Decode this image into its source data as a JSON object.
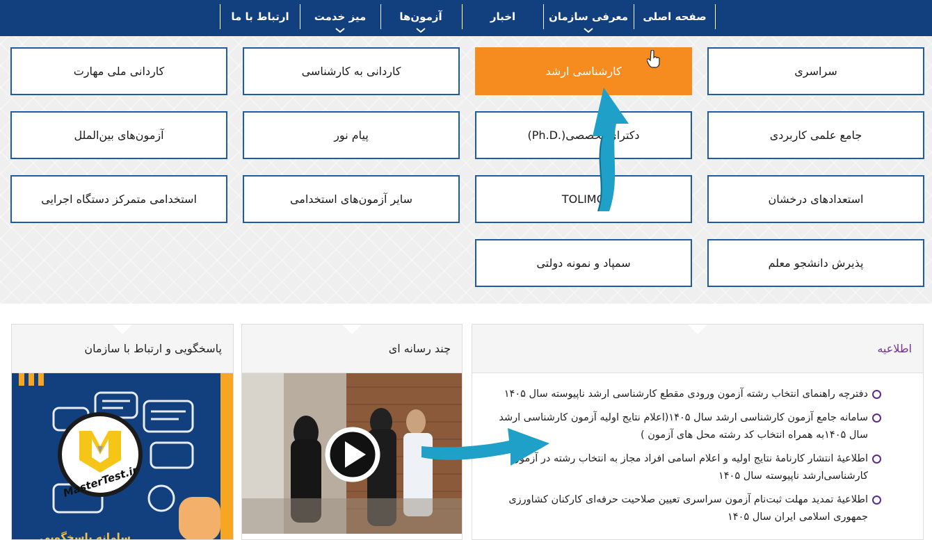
{
  "nav": {
    "items": [
      {
        "label": "صفحه اصلی",
        "dropdown": false
      },
      {
        "label": "معرفی سازمان",
        "dropdown": true
      },
      {
        "label": "اخبار",
        "dropdown": false
      },
      {
        "label": "آزمون‌ها",
        "dropdown": true
      },
      {
        "label": "میز خدمت",
        "dropdown": true
      },
      {
        "label": "ارتباط با ما",
        "dropdown": false
      }
    ]
  },
  "tiles": [
    {
      "label": "سراسری"
    },
    {
      "label": "کارشناسی ارشد",
      "active": true
    },
    {
      "label": "کاردانی به کارشناسی"
    },
    {
      "label": "کاردانی ملی مهارت"
    },
    {
      "label": "جامع علمی کاربردی"
    },
    {
      "label": "دکترای تخصصی(.Ph.D)"
    },
    {
      "label": "پیام نور"
    },
    {
      "label": "آزمون‌های بین‌الملل"
    },
    {
      "label": "استعدادهای درخشان"
    },
    {
      "label": "TOLIMO"
    },
    {
      "label": "سایر آزمون‌های استخدامی"
    },
    {
      "label": "استخدامی متمرکز دستگاه اجرایی"
    },
    {
      "label": "پذیرش دانشجو معلم"
    },
    {
      "label": "سمپاد و نمونه دولتی"
    }
  ],
  "panels": {
    "news": {
      "title": "اطلاعیه",
      "items": [
        "دفترچه راهنمای انتخاب رشته آزمون ورودی مقطع کارشناسی ارشد ناپیوسته سال ۱۴۰۵",
        "سامانه جامع آزمون کارشناسی ارشد سال ۱۴۰۵(اعلام نتایج اولیه آزمون کارشناسی ارشد سال ۱۴۰۵به همراه انتخاب کد رشته محل های آزمون )",
        "اطلاعیهٔ انتشار کارنامهٔ نتایج اولیه و اعلام اسامی افراد مجاز به انتخاب رشته در آزمون کارشناسی‌ارشد ناپیوسته سال ۱۴۰۵",
        "اطلاعیهٔ تمدید مهلت ثبت‌نام آزمون سراسری تعیین صلاحیت حرفه‌ای کارکنان کشاورزی جمهوری اسلامی ایران سال ۱۴۰۵"
      ]
    },
    "media": {
      "title": "چند رسانه ای"
    },
    "support": {
      "title": "پاسخگویی و ارتباط با سازمان",
      "caption": "سامانه پاسخگویی"
    }
  },
  "watermark": {
    "text": "MasterTest.ir"
  },
  "colors": {
    "nav_bg": "#12407f",
    "tile_border": "#1f5aa6",
    "active_tile": "#f68b1f",
    "bullet": "#5a2d82",
    "arrow": "#1ea0c8"
  },
  "icons": [
    "chevron-down-icon",
    "hand-cursor-icon",
    "play-icon",
    "chat-bubbles-icon",
    "bullet-circle-icon"
  ]
}
